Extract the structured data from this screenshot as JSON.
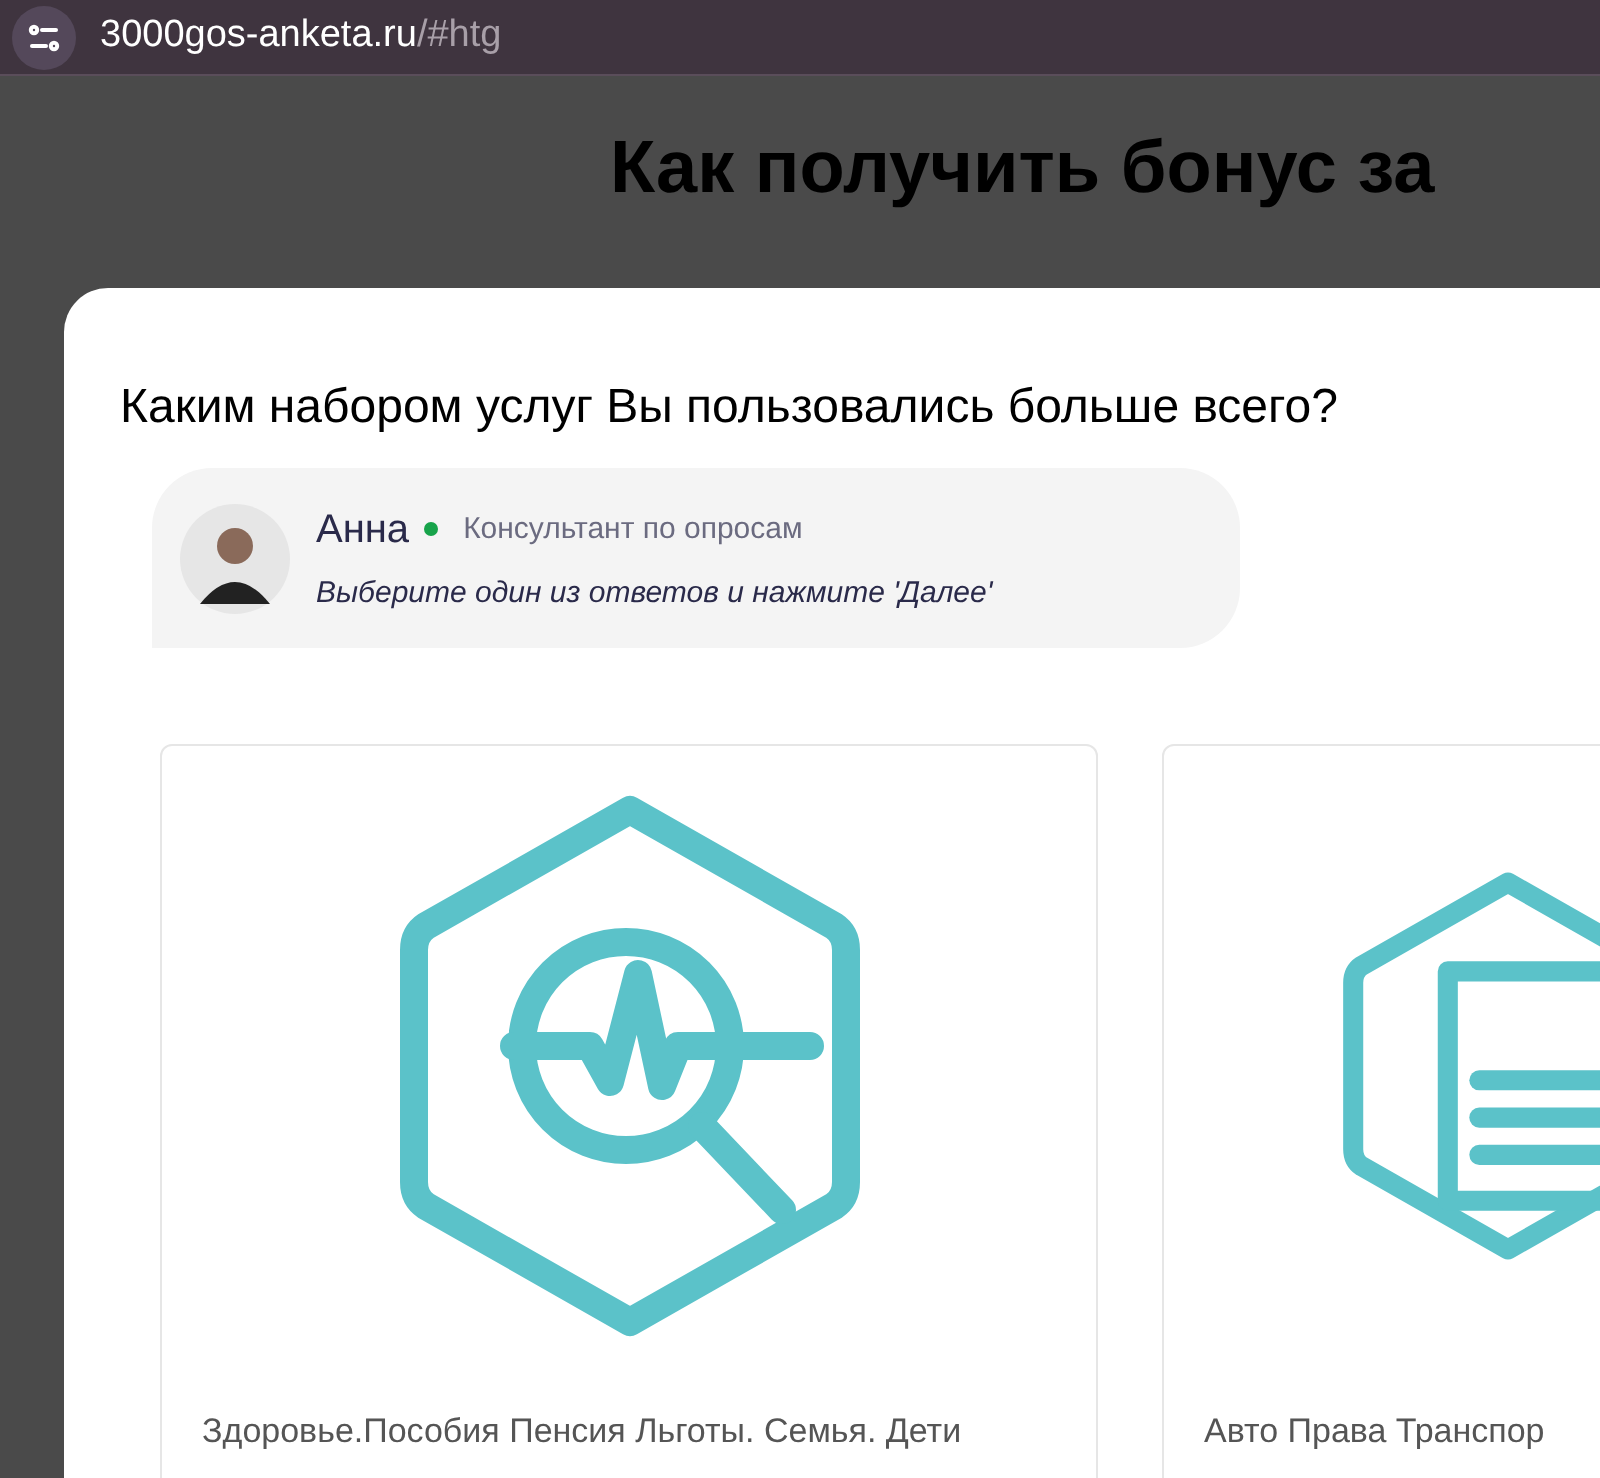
{
  "address_bar": {
    "domain": "3000gos-anketa.ru",
    "fragment": "/#htg"
  },
  "heading": "Как получить бонус за",
  "question": "Каким набором услуг Вы пользовались больше всего?",
  "consultant": {
    "name": "Анна",
    "online": true,
    "role": "Консультант по опросам",
    "message": "Выберите один из ответов и нажмите 'Далее'"
  },
  "options": [
    {
      "kind": "health",
      "label": "Здоровье.Пособия Пенсия Льготы. Семья. Дети"
    },
    {
      "kind": "document",
      "label": "Авто Права Транспор"
    }
  ]
}
